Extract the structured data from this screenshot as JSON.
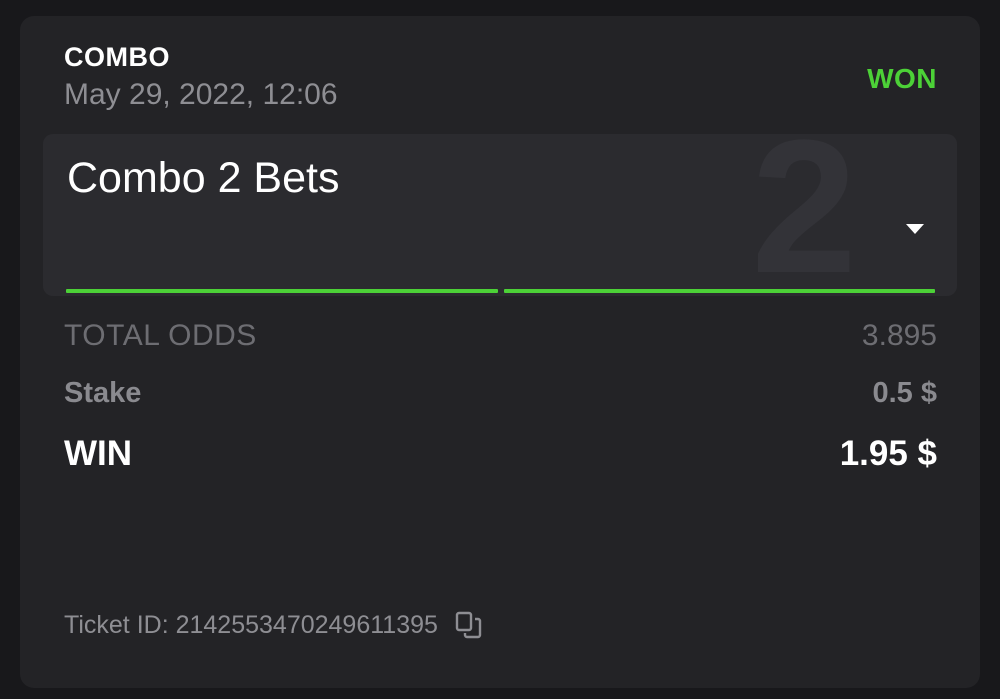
{
  "ticket": {
    "type_label": "COMBO",
    "date": "May 29, 2022, 12:06",
    "status": "WON",
    "status_color": "#4cd137",
    "combo": {
      "title": "Combo 2 Bets",
      "count_watermark": "2",
      "toggle_icon": "caret-down-icon",
      "legs": [
        {
          "status": "won"
        },
        {
          "status": "won"
        }
      ]
    },
    "total_odds_label": "TOTAL ODDS",
    "total_odds_value": "3.895",
    "stake_label": "Stake",
    "stake_value": "0.5 $",
    "win_label": "WIN",
    "win_value": "1.95 $",
    "ticket_id_text": "Ticket ID: 2142553470249611395",
    "copy_icon": "copy-icon"
  }
}
